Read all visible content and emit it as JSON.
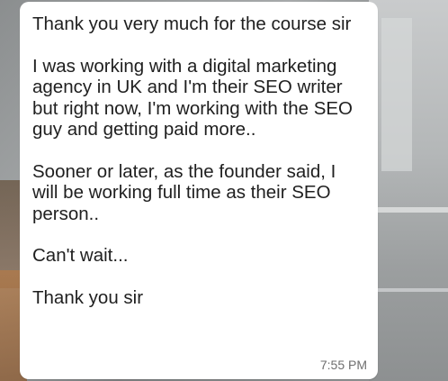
{
  "chat": {
    "message": {
      "text": "Thank you very much for the course sir\n\nI was working with a digital marketing agency in UK and I'm their SEO writer but right now, I'm working with the SEO guy and getting paid more..\n\nSooner or later, as the founder said, I will be working full time as their SEO person..\n\nCan't wait...\n\nThank you sir",
      "time": "7:55 PM"
    }
  },
  "colors": {
    "bubble": "#ffffff",
    "text": "#1f1f1f",
    "timestamp": "#6f6f6f"
  }
}
